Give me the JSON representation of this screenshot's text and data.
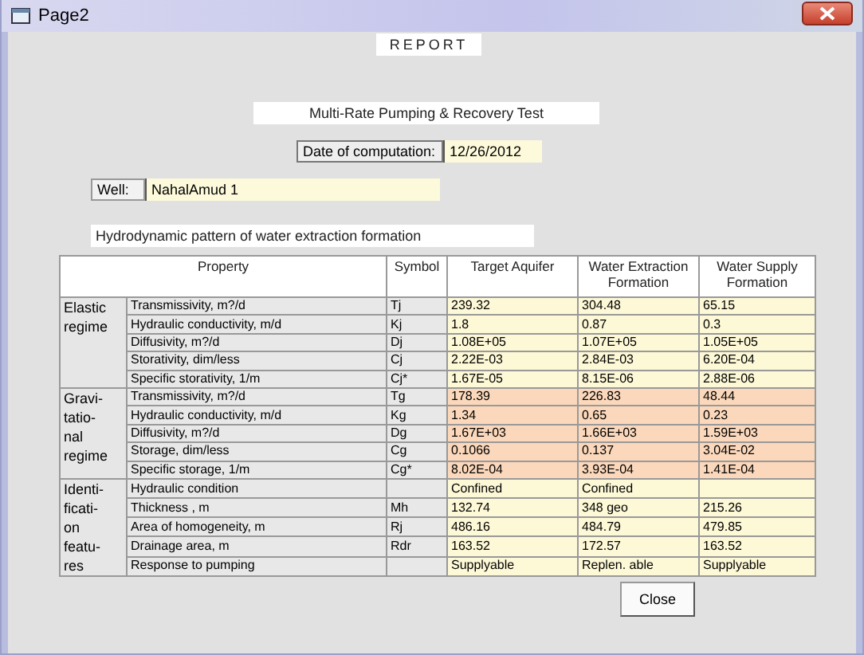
{
  "window": {
    "title": "Page2"
  },
  "report_label": "REPORT",
  "test_title": "Multi-Rate Pumping & Recovery Test",
  "date": {
    "label": "Date of computation:",
    "value": "12/26/2012"
  },
  "well": {
    "label": "Well:",
    "value": "NahalAmud 1"
  },
  "pattern_title": "Hydrodynamic pattern of water extraction formation",
  "table": {
    "columns": [
      "Property",
      "Symbol",
      "Target Aquifer",
      "Water Extraction Formation",
      "Water Supply Formation"
    ],
    "groups": [
      {
        "label": "Elastic regime",
        "color": "#fdf8d6",
        "rows": [
          {
            "property": "Transmissivity, m?/d",
            "symbol": "Tj",
            "values": [
              "239.32",
              "304.48",
              "65.15"
            ]
          },
          {
            "property": "Hydraulic conductivity, m/d",
            "symbol": "Kj",
            "values": [
              "1.8",
              "0.87",
              "0.3"
            ]
          },
          {
            "property": "Diffusivity, m?/d",
            "symbol": "Dj",
            "values": [
              "1.08E+05",
              "1.07E+05",
              "1.05E+05"
            ]
          },
          {
            "property": "Storativity, dim/less",
            "symbol": "Cj",
            "values": [
              "2.22E-03",
              "2.84E-03",
              "6.20E-04"
            ]
          },
          {
            "property": "Specific storativity, 1/m",
            "symbol": "Cj*",
            "values": [
              "1.67E-05",
              "8.15E-06",
              "2.88E-06"
            ]
          }
        ]
      },
      {
        "label": "Gravi-tatio-nal regime",
        "color": "#fbd8bb",
        "rows": [
          {
            "property": "Transmissivity, m?/d",
            "symbol": "Tg",
            "values": [
              "178.39",
              "226.83",
              "48.44"
            ]
          },
          {
            "property": "Hydraulic conductivity, m/d",
            "symbol": "Kg",
            "values": [
              "1.34",
              "0.65",
              "0.23"
            ]
          },
          {
            "property": "Diffusivity, m?/d",
            "symbol": "Dg",
            "values": [
              "1.67E+03",
              "1.66E+03",
              "1.59E+03"
            ]
          },
          {
            "property": "Storage, dim/less",
            "symbol": "Cg",
            "values": [
              "0.1066",
              "0.137",
              "3.04E-02"
            ]
          },
          {
            "property": "Specific storage, 1/m",
            "symbol": "Cg*",
            "values": [
              "8.02E-04",
              "3.93E-04",
              "1.41E-04"
            ]
          }
        ]
      },
      {
        "label": "Identi-ficati-on featu-res",
        "color": "#fdf8d6",
        "rows": [
          {
            "property": "Hydraulic condition",
            "values": [
              "Confined",
              "Confined"
            ]
          },
          {
            "property": "Thickness , m",
            "symbol": "Mh",
            "values": [
              "132.74",
              "348 geo",
              "215.26"
            ]
          },
          {
            "property": "Area of homogeneity, m",
            "symbol": "Rj",
            "values": [
              "486.16",
              "484.79",
              "479.85"
            ]
          },
          {
            "property": "Drainage area, m",
            "symbol": "Rdr",
            "values": [
              "163.52",
              "172.57",
              "163.52"
            ]
          },
          {
            "property": "Response to pumping",
            "values": [
              "Supplyable",
              "Replen. able",
              "Supplyable"
            ]
          }
        ]
      }
    ]
  },
  "buttons": [
    "Close"
  ]
}
